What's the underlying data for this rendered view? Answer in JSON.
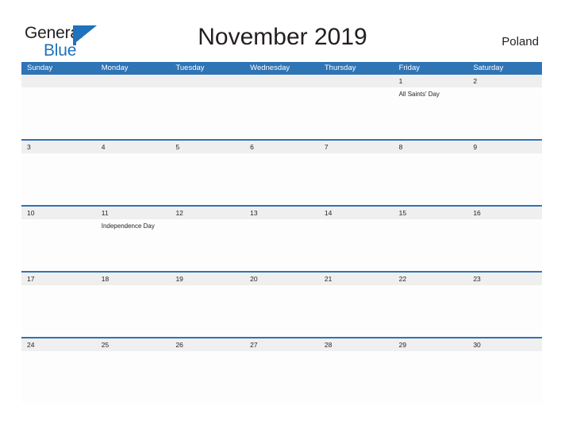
{
  "brand": {
    "name_part1": "General",
    "name_part2": "Blue",
    "flag_icon": "flag-icon",
    "accent_color": "#1f72bd"
  },
  "header": {
    "title": "November 2019",
    "country": "Poland"
  },
  "theme": {
    "header_blue": "#2f74b5",
    "date_band_gray": "#efefef",
    "text_color": "#231f20"
  },
  "calendar": {
    "weekdays": [
      "Sunday",
      "Monday",
      "Tuesday",
      "Wednesday",
      "Thursday",
      "Friday",
      "Saturday"
    ],
    "weeks": [
      {
        "dates": [
          "",
          "",
          "",
          "",
          "",
          "1",
          "2"
        ],
        "events": [
          "",
          "",
          "",
          "",
          "",
          "All Saints' Day",
          ""
        ]
      },
      {
        "dates": [
          "3",
          "4",
          "5",
          "6",
          "7",
          "8",
          "9"
        ],
        "events": [
          "",
          "",
          "",
          "",
          "",
          "",
          ""
        ]
      },
      {
        "dates": [
          "10",
          "11",
          "12",
          "13",
          "14",
          "15",
          "16"
        ],
        "events": [
          "",
          "Independence Day",
          "",
          "",
          "",
          "",
          ""
        ]
      },
      {
        "dates": [
          "17",
          "18",
          "19",
          "20",
          "21",
          "22",
          "23"
        ],
        "events": [
          "",
          "",
          "",
          "",
          "",
          "",
          ""
        ]
      },
      {
        "dates": [
          "24",
          "25",
          "26",
          "27",
          "28",
          "29",
          "30"
        ],
        "events": [
          "",
          "",
          "",
          "",
          "",
          "",
          ""
        ]
      }
    ]
  }
}
